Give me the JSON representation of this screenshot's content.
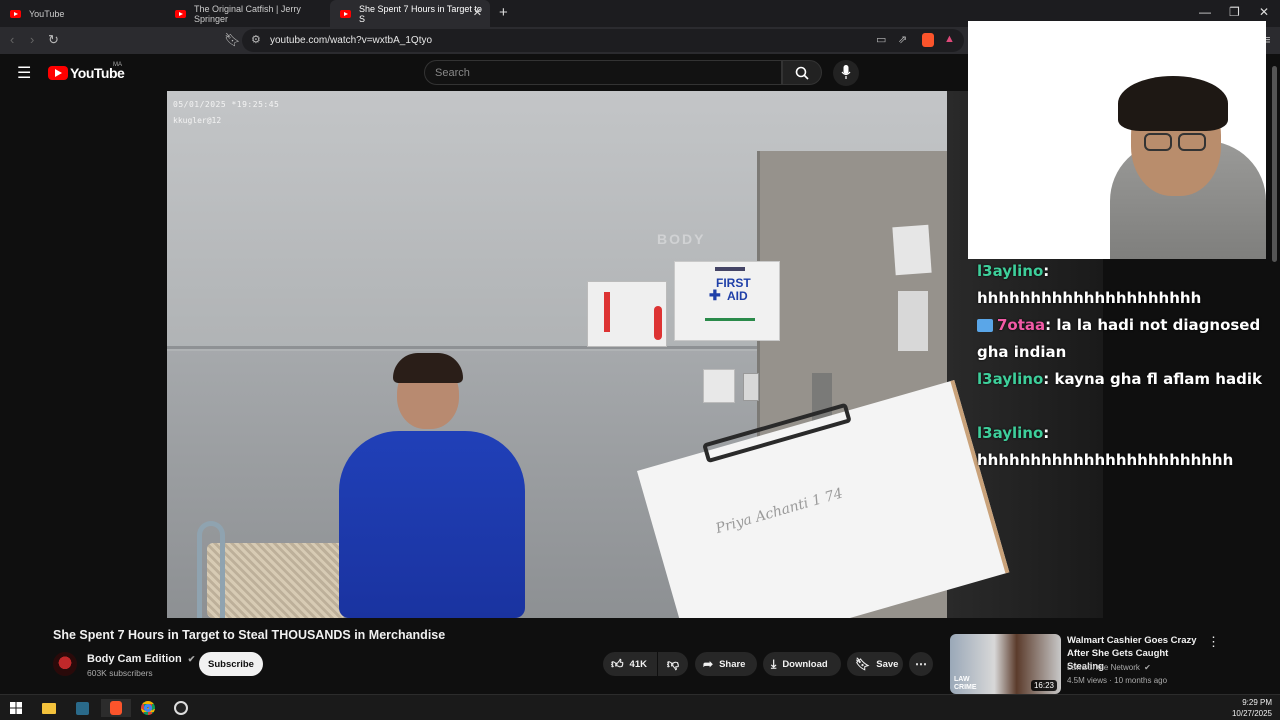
{
  "browser": {
    "tabs": [
      {
        "label": "YouTube",
        "active": false
      },
      {
        "label": "The Original Catfish | Jerry Springer",
        "active": false
      },
      {
        "label": "She Spent 7 Hours in Target to S",
        "active": true
      }
    ],
    "new_tab": "+",
    "url": "youtube.com/watch?v=wxtbA_1Qtyo"
  },
  "youtube": {
    "logo_text": "YouTube",
    "country_code": "MA",
    "search_placeholder": "Search"
  },
  "video": {
    "timestamp_overlay": "05/01/2025 *19:25:45",
    "officer_overlay": "kkugler@12",
    "watermark": "BODY",
    "sign_first": "FIRST",
    "sign_aid": "AID",
    "whiteboard_text": "Priya Achanti  1  74"
  },
  "chat": {
    "messages": [
      {
        "user": "l3aylino",
        "text": "hhhhhhhhhhhhhhhhhhhhh",
        "color": "#3ecf9b"
      },
      {
        "user": "7otaa",
        "text": "la la hadi not diagnosed gha indian",
        "color": "#f25aa6"
      },
      {
        "user": "l3aylino",
        "text": "kayna gha fl aflam hadik",
        "color": "#3ecf9b"
      },
      {
        "user": "l3aylino",
        "text": "hhhhhhhhhhhhhhhhhhhhhhhh",
        "color": "#3ecf9b"
      }
    ]
  },
  "watch": {
    "title": "She Spent 7 Hours in Target to Steal THOUSANDS in Merchandise",
    "channel": "Body Cam Edition",
    "subscribers": "603K subscribers",
    "subscribe_label": "Subscribe",
    "likes": "41K",
    "share_label": "Share",
    "download_label": "Download",
    "save_label": "Save"
  },
  "recommendation": {
    "title": "Walmart Cashier Goes Crazy After She Gets Caught Stealing",
    "channel": "Law&Crime Network",
    "meta": "4.5M views · 10 months ago",
    "duration": "16:23",
    "thumb_text": "LAW CRIME"
  },
  "taskbar": {
    "time": "9:29 PM",
    "date": "10/27/2025"
  }
}
